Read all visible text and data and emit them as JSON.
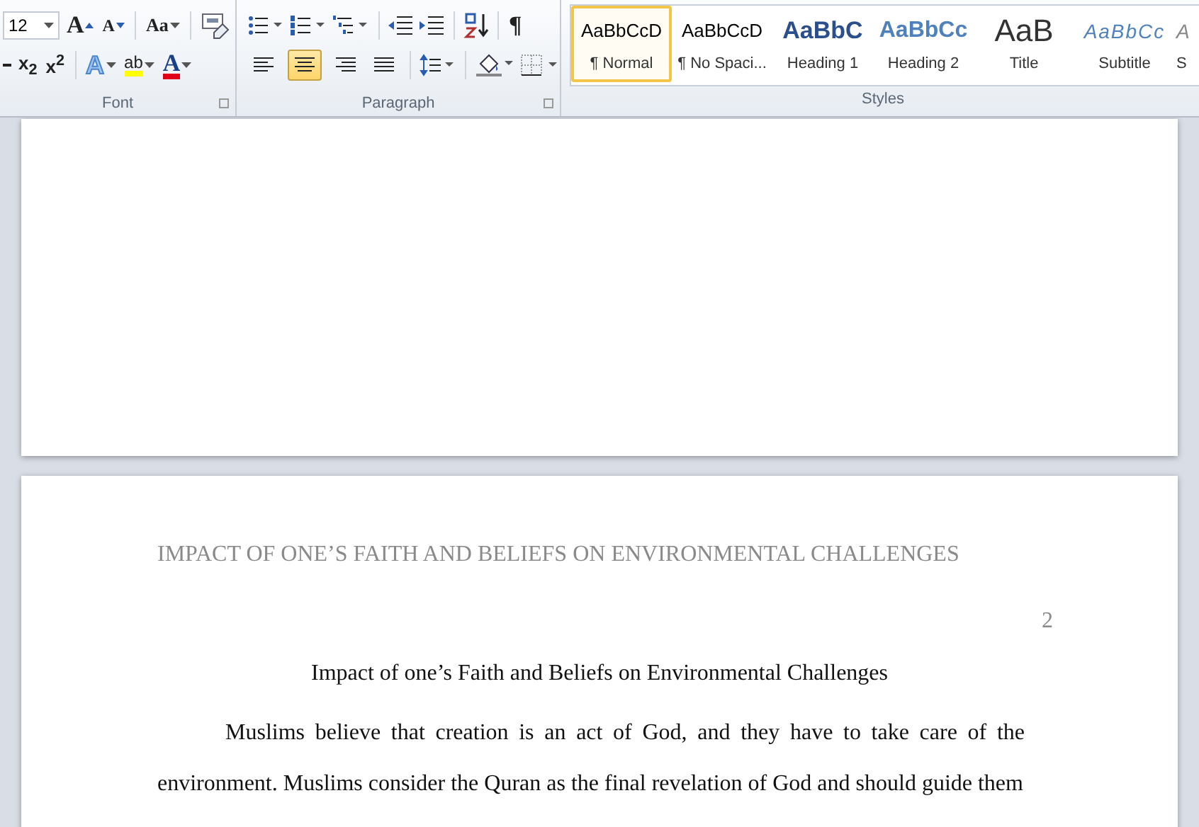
{
  "ribbon": {
    "font_group": {
      "label": "Font",
      "font_size": "12",
      "grow": "A",
      "shrink": "A",
      "change_case": "Aa",
      "subscript": "x$_{2}$",
      "superscript": "x$^{2}$",
      "text_effects": "A",
      "highlight": "ab",
      "font_color": "A"
    },
    "paragraph_group": {
      "label": "Paragraph",
      "pilcrow": "¶",
      "alignments": [
        {
          "kind": "left",
          "selected": false
        },
        {
          "kind": "center",
          "selected": true
        },
        {
          "kind": "right",
          "selected": false
        },
        {
          "kind": "justify",
          "selected": false
        }
      ]
    },
    "styles": {
      "label": "Styles",
      "items": [
        {
          "kind": "normal",
          "preview": "AaBbCcD",
          "name": "¶ Normal",
          "selected": true
        },
        {
          "kind": "normal",
          "preview": "AaBbCcD",
          "name": "¶ No Spaci...",
          "selected": false
        },
        {
          "kind": "heading1",
          "preview": "AaBbC",
          "name": "Heading 1",
          "selected": false
        },
        {
          "kind": "heading2",
          "preview": "AaBbCc",
          "name": "Heading 2",
          "selected": false
        },
        {
          "kind": "title",
          "preview": "AaB",
          "name": "Title",
          "selected": false
        },
        {
          "kind": "subtitle",
          "preview": "AaBbCc",
          "name": "Subtitle",
          "selected": false
        },
        {
          "kind": "emphasis",
          "preview": "A",
          "name": "S",
          "selected": false
        }
      ]
    }
  },
  "document": {
    "header": "IMPACT OF ONE’S FAITH AND BELIEFS ON ENVIRONMENTAL CHALLENGES",
    "page_number": "2",
    "title": "Impact of one’s Faith and Beliefs on Environmental Challenges",
    "paragraph": "Muslims believe that creation is an act of God, and they have to take care of the environment. Muslims consider the Quran as the final revelation of God and should guide them"
  }
}
